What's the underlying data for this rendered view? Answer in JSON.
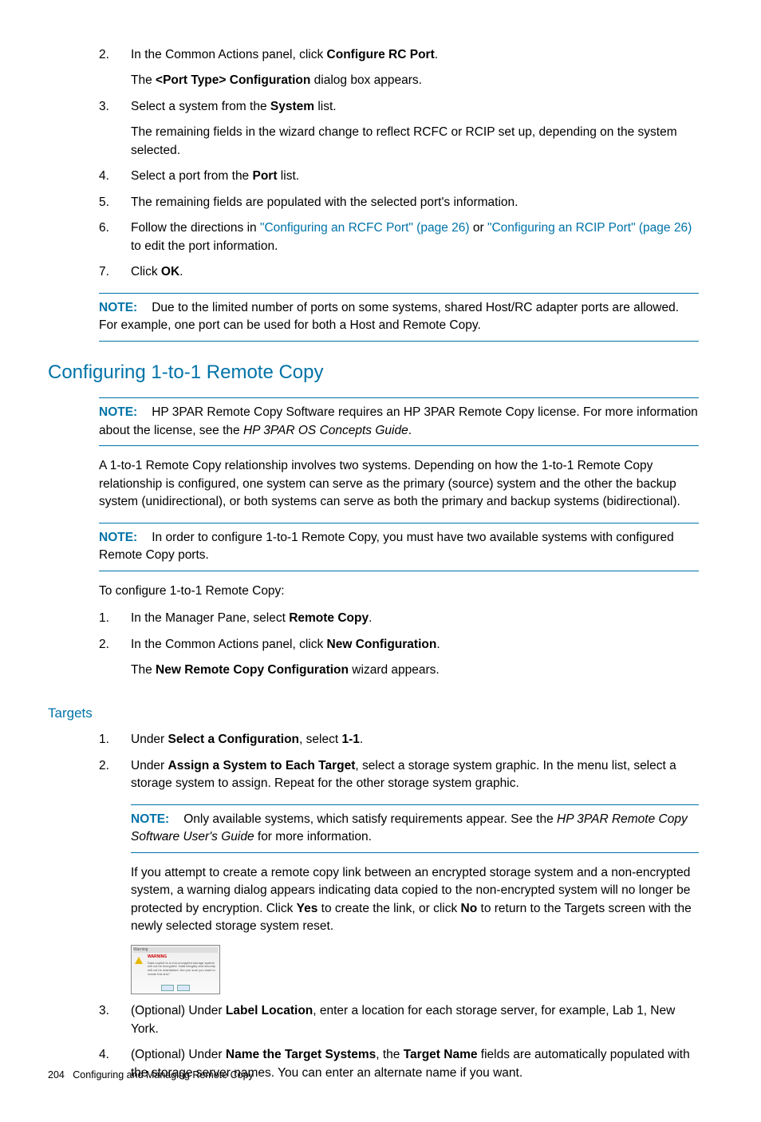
{
  "steps_top": [
    {
      "num": "2.",
      "lines": [
        [
          {
            "t": "In the Common Actions panel, click "
          },
          {
            "t": "Configure RC Port",
            "b": true
          },
          {
            "t": "."
          }
        ],
        [
          {
            "t": "The "
          },
          {
            "t": "<Port Type> Configuration",
            "b": true
          },
          {
            "t": " dialog box appears."
          }
        ]
      ]
    },
    {
      "num": "3.",
      "lines": [
        [
          {
            "t": "Select a system from the "
          },
          {
            "t": "System",
            "b": true
          },
          {
            "t": " list."
          }
        ],
        [
          {
            "t": "The remaining fields in the wizard change to reflect RCFC or RCIP set up, depending on the system selected."
          }
        ]
      ]
    },
    {
      "num": "4.",
      "lines": [
        [
          {
            "t": "Select a port from the "
          },
          {
            "t": "Port",
            "b": true
          },
          {
            "t": " list."
          }
        ]
      ]
    },
    {
      "num": "5.",
      "lines": [
        [
          {
            "t": "The remaining fields are populated with the selected port's information."
          }
        ]
      ]
    },
    {
      "num": "6.",
      "lines": [
        [
          {
            "t": "Follow the directions in "
          },
          {
            "t": "\"Configuring an RCFC Port\" (page 26)",
            "link": true
          },
          {
            "t": " or "
          },
          {
            "t": "\"Configuring an RCIP Port\" (page 26)",
            "link": true
          },
          {
            "t": " to edit the port information."
          }
        ]
      ]
    },
    {
      "num": "7.",
      "lines": [
        [
          {
            "t": "Click "
          },
          {
            "t": "OK",
            "b": true
          },
          {
            "t": "."
          }
        ]
      ]
    }
  ],
  "note1": {
    "label": "NOTE:",
    "text": "Due to the limited number of ports on some systems, shared Host/RC adapter ports are allowed. For example, one port can be used for both a Host and Remote Copy."
  },
  "heading1": "Configuring 1-to-1 Remote Copy",
  "note2": {
    "label": "NOTE:",
    "frags": [
      {
        "t": "HP 3PAR Remote Copy Software requires an HP 3PAR Remote Copy license. For more information about the license, see the "
      },
      {
        "t": "HP 3PAR OS Concepts Guide",
        "i": true
      },
      {
        "t": "."
      }
    ]
  },
  "para1": "A 1-to-1 Remote Copy relationship involves two systems. Depending on how the 1-to-1 Remote Copy relationship is configured, one system can serve as the primary (source) system and the other the backup system (unidirectional), or both systems can serve as both the primary and backup systems (bidirectional).",
  "note3": {
    "label": "NOTE:",
    "text": "In order to configure 1-to-1 Remote Copy, you must have two available systems with configured Remote Copy ports."
  },
  "para2": "To configure 1-to-1 Remote Copy:",
  "steps_mid": [
    {
      "num": "1.",
      "lines": [
        [
          {
            "t": "In the Manager Pane, select "
          },
          {
            "t": "Remote Copy",
            "b": true
          },
          {
            "t": "."
          }
        ]
      ]
    },
    {
      "num": "2.",
      "lines": [
        [
          {
            "t": "In the Common Actions panel, click "
          },
          {
            "t": "New Configuration",
            "b": true
          },
          {
            "t": "."
          }
        ],
        [
          {
            "t": "The "
          },
          {
            "t": "New Remote Copy Configuration",
            "b": true
          },
          {
            "t": " wizard appears."
          }
        ]
      ]
    }
  ],
  "heading2": "Targets",
  "steps_targets": [
    {
      "num": "1.",
      "lines": [
        [
          {
            "t": "Under "
          },
          {
            "t": "Select a Configuration",
            "b": true
          },
          {
            "t": ", select "
          },
          {
            "t": "1-1",
            "b": true
          },
          {
            "t": "."
          }
        ]
      ]
    },
    {
      "num": "2.",
      "lines": [
        [
          {
            "t": "Under "
          },
          {
            "t": "Assign a System to Each Target",
            "b": true
          },
          {
            "t": ", select a storage system graphic. In the menu list, select a storage system to assign. Repeat for the other storage system graphic."
          }
        ]
      ]
    }
  ],
  "note4": {
    "label": "NOTE:",
    "frags": [
      {
        "t": "Only available systems, which satisfy requirements appear. See the "
      },
      {
        "t": "HP 3PAR Remote Copy Software User's Guide",
        "i": true
      },
      {
        "t": " for more information."
      }
    ]
  },
  "para3": [
    {
      "t": "If you attempt to create a remote copy link between an encrypted storage system and a non-encrypted system, a warning dialog appears indicating data copied to the non-encrypted system will no longer be protected by encryption. Click "
    },
    {
      "t": "Yes",
      "b": true
    },
    {
      "t": " to create the link, or click "
    },
    {
      "t": "No",
      "b": true
    },
    {
      "t": " to return to the Targets screen with the newly selected storage system reset."
    }
  ],
  "steps_targets2": [
    {
      "num": "3.",
      "lines": [
        [
          {
            "t": "(Optional) Under "
          },
          {
            "t": "Label Location",
            "b": true
          },
          {
            "t": ", enter a location for each storage server, for example, Lab 1, New York."
          }
        ]
      ]
    },
    {
      "num": "4.",
      "lines": [
        [
          {
            "t": "(Optional) Under "
          },
          {
            "t": "Name the Target Systems",
            "b": true
          },
          {
            "t": ", the "
          },
          {
            "t": "Target Name",
            "b": true
          },
          {
            "t": " fields are automatically populated with the storage server names. You can enter an alternate name if you want."
          }
        ]
      ]
    }
  ],
  "dialog": {
    "title": "Warning",
    "warn": "WARNING",
    "body": "Data copied to a non-encrypted storage system will not be encrypted. Data integrity and security will not be maintained. Are you sure you want to create this link?"
  },
  "footer": {
    "page": "204",
    "chapter": "Configuring and Managing Remote Copy"
  }
}
